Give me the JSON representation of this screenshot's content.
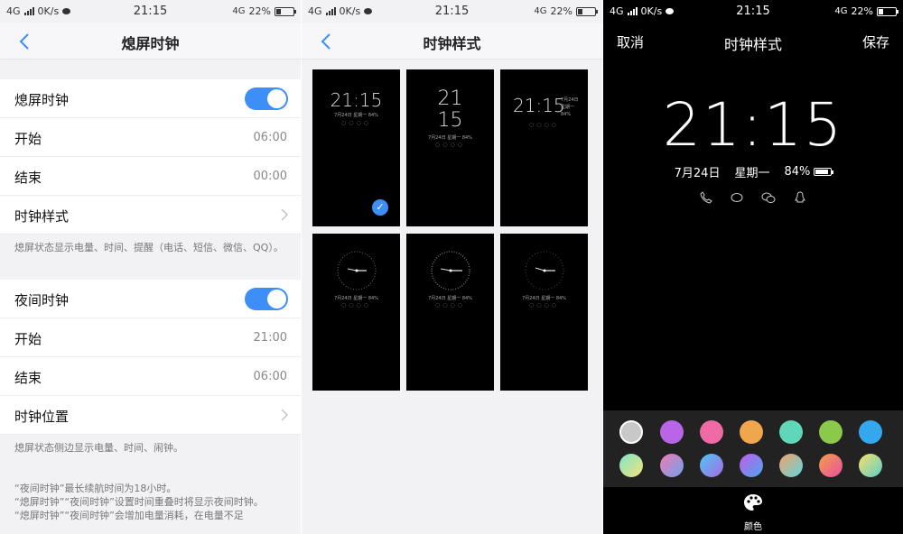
{
  "status": {
    "network": "4G",
    "speed": "0K/s",
    "time": "21:15",
    "battery": "22%"
  },
  "panel1": {
    "title": "熄屏时钟",
    "section1": {
      "toggle_label": "熄屏时钟",
      "start_label": "开始",
      "start_value": "06:00",
      "end_label": "结束",
      "end_value": "00:00",
      "style_label": "时钟样式",
      "note": "熄屏状态显示电量、时间、提醒（电话、短信、微信、QQ）。"
    },
    "section2": {
      "toggle_label": "夜间时钟",
      "start_label": "开始",
      "start_value": "21:00",
      "end_label": "结束",
      "end_value": "06:00",
      "position_label": "时钟位置",
      "note": "熄屏状态侧边显示电量、时间、闹钟。"
    },
    "footnotes": [
      "“夜间时钟”最长续航时间为18小时。",
      "“熄屏时钟”“夜间时钟”设置时间重叠时将显示夜间时钟。",
      "“熄屏时钟”“夜间时钟”会增加电量消耗，在电量不足"
    ]
  },
  "panel2": {
    "title": "时钟样式",
    "thumb_time": "21:15",
    "thumb_hour": "21",
    "thumb_minute": "15",
    "thumb_date": "7月24日",
    "thumb_weekday": "星期一",
    "thumb_battery": "84%"
  },
  "panel3": {
    "cancel": "取消",
    "title": "时钟样式",
    "save": "保存",
    "time": "21:15",
    "date": "7月24日",
    "weekday": "星期一",
    "battery": "84%",
    "palette_tab_label": "颜色",
    "colors_row1": [
      "#c8c8c8",
      "#b865e8",
      "#f06aa5",
      "#f0a64c",
      "#5fd7b8",
      "#8bc94b",
      "#35a7ef"
    ],
    "colors_row2": [
      "gradient-mint-yellow",
      "gradient-pink-blue",
      "gradient-blue-purple",
      "gradient-violet-blue",
      "gradient-peach-cyan",
      "gradient-orange-pink",
      "gradient-yellow-teal"
    ]
  }
}
